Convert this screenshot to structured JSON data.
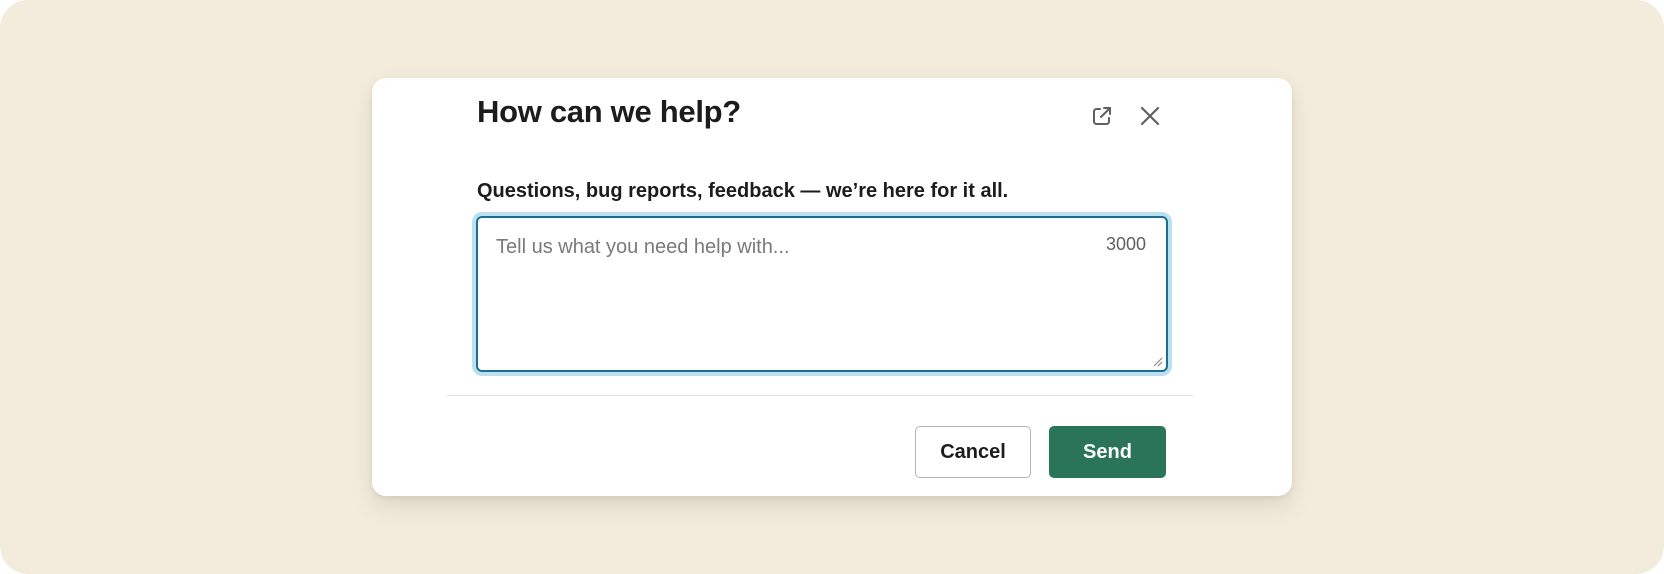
{
  "dialog": {
    "title": "How can we help?",
    "prompt": "Questions, bug reports, feedback — we’re here for it all.",
    "textarea": {
      "placeholder": "Tell us what you need help with...",
      "value": "",
      "char_limit": "3000"
    },
    "buttons": {
      "cancel_label": "Cancel",
      "send_label": "Send"
    },
    "icons": {
      "popout": "external-link-icon",
      "close": "close-icon"
    }
  },
  "colors": {
    "page_background": "#f3ecdc",
    "focus_ring": "#1d9bd1",
    "send_button": "#2a7458"
  }
}
